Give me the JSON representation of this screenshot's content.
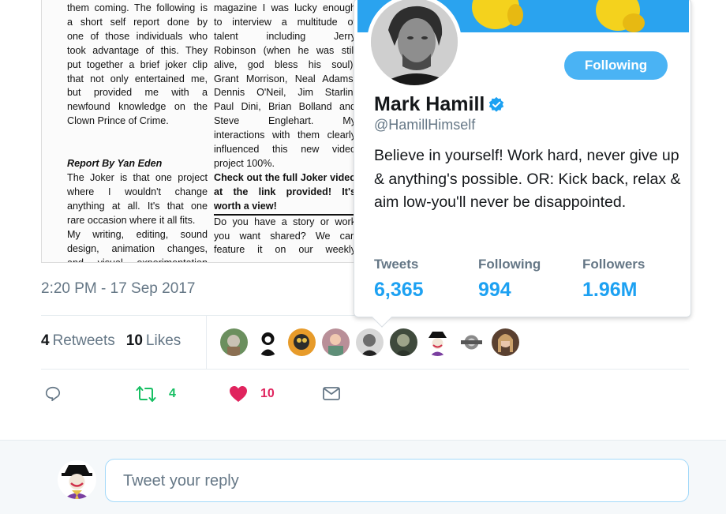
{
  "magazine": {
    "col1": [
      {
        "t": "them coming. The following is"
      },
      {
        "t": "a short self report done by"
      },
      {
        "t": "one of those individuals who"
      },
      {
        "t": "took advantage of this. They"
      },
      {
        "t": "put together a brief joker clip"
      },
      {
        "t": "that not only entertained me,"
      },
      {
        "t": "but provided me with a"
      },
      {
        "t": "newfound knowledge on the"
      },
      {
        "t": "Clown Prince of Crime.",
        "last": true
      },
      {
        "gap": true
      },
      {
        "gap": true
      },
      {
        "t": "Report By Yan Eden",
        "style": "bi",
        "last": true
      },
      {
        "t": "The Joker is that one project"
      },
      {
        "t": "where I wouldn't change"
      },
      {
        "t": "anything at all. It's that one"
      },
      {
        "t": "rare occasion where it all fits.",
        "last": true
      },
      {
        "t": "My writing, editing, sound"
      },
      {
        "t": "design, animation changes,"
      },
      {
        "t": "and visual experimentation"
      }
    ],
    "col2": [
      {
        "t": "magazine I was lucky enough"
      },
      {
        "t": "to interview a multitude of"
      },
      {
        "t": "talent including Jerry"
      },
      {
        "t": "Robinson (when he was still"
      },
      {
        "t": "alive, god bless his soul),"
      },
      {
        "t": "Grant Morrison, Neal Adams,"
      },
      {
        "t": "Dennis O'Neil, Jim Starlin,"
      },
      {
        "t": "Paul Dini, Brian Bolland and"
      },
      {
        "t": "Steve Englehart. My"
      },
      {
        "t": "interactions with them clearly"
      },
      {
        "t": "influenced this new video"
      },
      {
        "t": "project 100%.",
        "last": true
      },
      {
        "t": "Check out the full Joker video",
        "style": "b"
      },
      {
        "t": "at the link provided! It's",
        "style": "b"
      },
      {
        "t": "worth a view!",
        "style": "b rule",
        "last": true
      },
      {
        "t": "Do you have a story or work"
      },
      {
        "t": "you want shared? We can"
      },
      {
        "t": "feature it on our weekly"
      }
    ]
  },
  "tweet": {
    "timestamp": "2:20 PM - 17 Sep 2017",
    "retweets_count": "4",
    "retweets_label": "Retweets",
    "likes_count": "10",
    "likes_label": "Likes",
    "actions": {
      "reply_icon": "reply-icon",
      "retweet_icon": "retweet-icon",
      "retweet_count": "4",
      "like_icon": "heart-icon",
      "like_count": "10",
      "dm_icon": "envelope-icon"
    }
  },
  "reply": {
    "placeholder": "Tweet your reply"
  },
  "hover_card": {
    "name": "Mark Hamill",
    "handle": "@HamillHimself",
    "follow_button": "Following",
    "bio": "Believe in yourself! Work hard, never give up & anything's possible. OR: Kick back, relax & aim low-you'll never be disappointed.",
    "stats": [
      {
        "label": "Tweets",
        "value": "6,365"
      },
      {
        "label": "Following",
        "value": "994"
      },
      {
        "label": "Followers",
        "value": "1.96M"
      }
    ]
  },
  "colors": {
    "accent": "#1da1f2",
    "muted": "#657786",
    "retweet_green": "#17bf63",
    "like_red": "#e0245e",
    "button_blue": "#4ab3f4"
  }
}
